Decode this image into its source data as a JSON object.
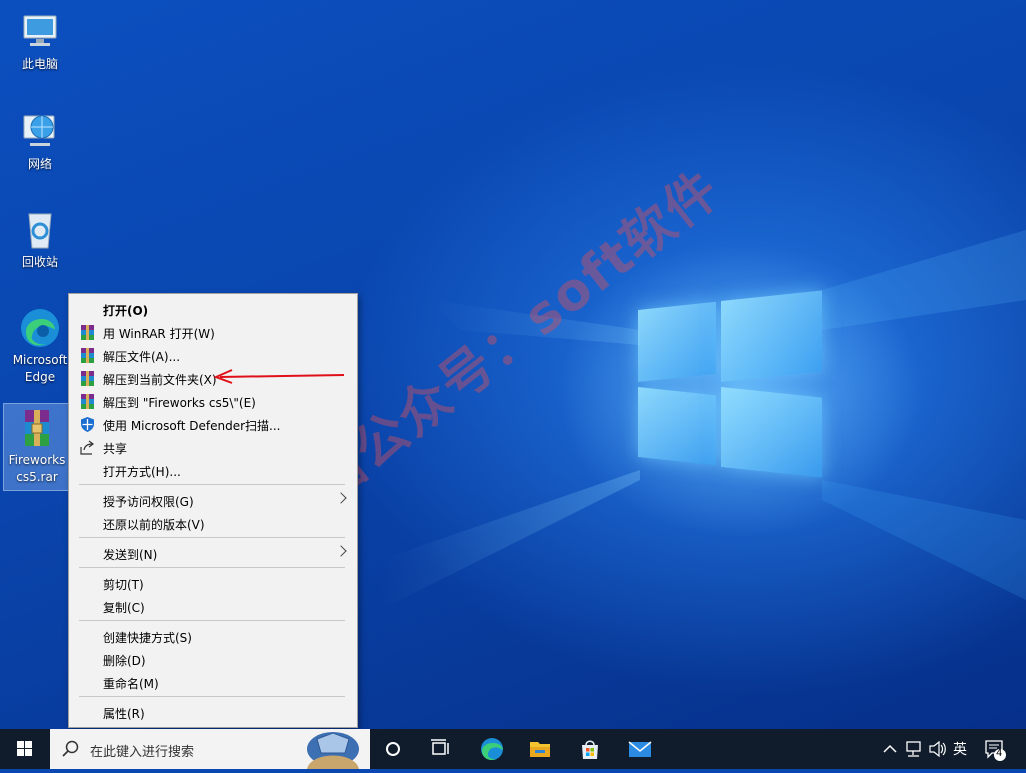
{
  "desktop": {
    "icons": [
      {
        "label_line1": "此电脑",
        "label_line2": "",
        "icon": "computer-icon"
      },
      {
        "label_line1": "网络",
        "label_line2": "",
        "icon": "network-icon"
      },
      {
        "label_line1": "回收站",
        "label_line2": "",
        "icon": "recycle-bin-icon"
      },
      {
        "label_line1": "Microsoft",
        "label_line2": "Edge",
        "icon": "edge-icon"
      },
      {
        "label_line1": "Fireworks",
        "label_line2": "cs5.rar",
        "icon": "winrar-archive-icon"
      }
    ]
  },
  "watermark": "微信公众号：soft软件",
  "context_menu": {
    "items": [
      {
        "label": "打开(O)"
      },
      {
        "label": "用 WinRAR 打开(W)",
        "icon": "winrar-icon"
      },
      {
        "label": "解压文件(A)...",
        "icon": "winrar-icon"
      },
      {
        "label": "解压到当前文件夹(X)",
        "icon": "winrar-icon"
      },
      {
        "label": "解压到 \"Fireworks cs5\\\"(E)",
        "icon": "winrar-icon"
      },
      {
        "label": "使用 Microsoft Defender扫描...",
        "icon": "defender-shield-icon"
      },
      {
        "label": "共享",
        "icon": "share-icon"
      },
      {
        "label": "打开方式(H)..."
      },
      {
        "label": "授予访问权限(G)",
        "submenu": true
      },
      {
        "label": "还原以前的版本(V)"
      },
      {
        "label": "发送到(N)",
        "submenu": true
      },
      {
        "label": "剪切(T)"
      },
      {
        "label": "复制(C)"
      },
      {
        "label": "创建快捷方式(S)"
      },
      {
        "label": "删除(D)"
      },
      {
        "label": "重命名(M)"
      },
      {
        "label": "属性(R)"
      }
    ]
  },
  "taskbar": {
    "search_placeholder": "在此键入进行搜索",
    "apps": [
      "task-view-icon",
      "edge-icon",
      "file-explorer-icon",
      "store-icon",
      "mail-icon"
    ],
    "tray": {
      "ime": "英",
      "notification_count": "4"
    }
  },
  "colors": {
    "accent_arrow": "#e0101a",
    "taskbar": "#101c2c",
    "desktop_blue": "#0a47b0"
  }
}
